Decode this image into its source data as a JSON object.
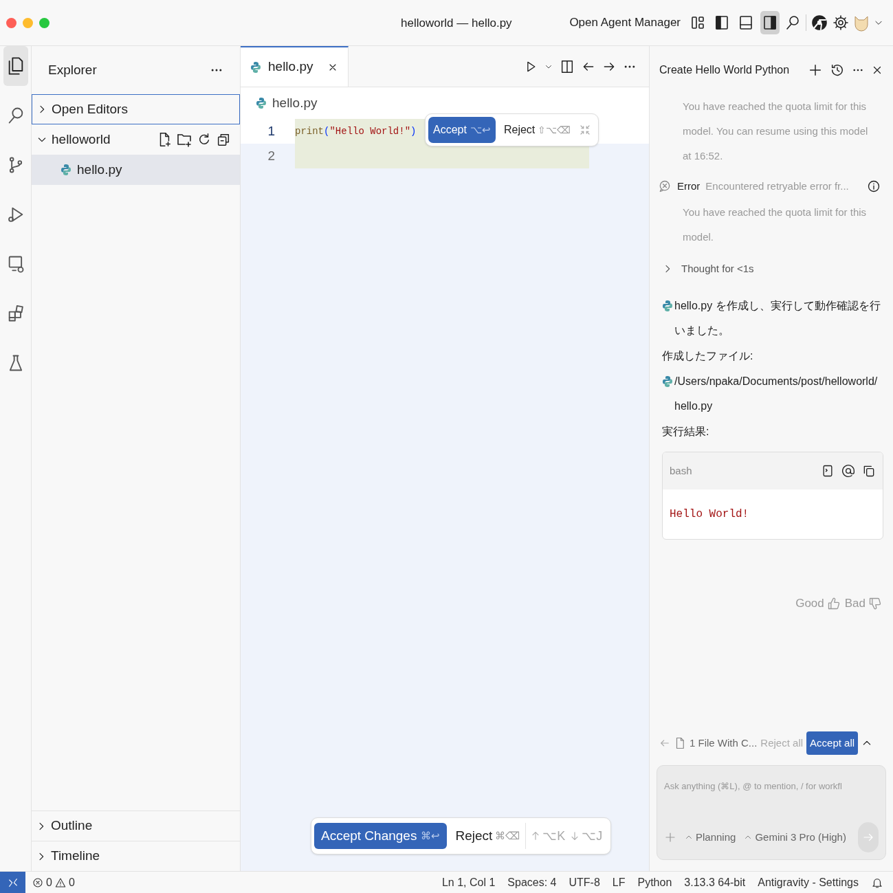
{
  "window": {
    "title": "helloworld — hello.py"
  },
  "title_bar": {
    "agent_manager": "Open Agent Manager",
    "layout_buttons": [
      {
        "kind": "customize",
        "selected": false
      },
      {
        "kind": "left",
        "selected": false
      },
      {
        "kind": "panel",
        "selected": false
      },
      {
        "kind": "right",
        "selected": true
      }
    ]
  },
  "activity_bar": [
    {
      "kind": "explorer",
      "selected": true
    },
    {
      "kind": "search",
      "selected": false
    },
    {
      "kind": "source_control",
      "selected": false
    },
    {
      "kind": "run",
      "selected": false
    },
    {
      "kind": "remote",
      "selected": false
    },
    {
      "kind": "extensions",
      "selected": false
    },
    {
      "kind": "testing",
      "selected": false
    }
  ],
  "sidebar": {
    "title": "Explorer",
    "sections": [
      {
        "label": "Open Editors",
        "expanded": false,
        "focused": true
      },
      {
        "label": "helloworld",
        "expanded": true,
        "focused": false,
        "files": [
          {
            "name": "hello.py",
            "selected": true
          }
        ]
      }
    ],
    "bottom_sections": [
      {
        "label": "Outline",
        "expanded": false
      },
      {
        "label": "Timeline",
        "expanded": false
      }
    ]
  },
  "editor": {
    "tabs": [
      {
        "label": "hello.py",
        "selected": true
      }
    ],
    "breadcrumb": "hello.py",
    "lines": [
      {
        "number": "1",
        "tokens": [
          {
            "kind": "function",
            "text": "print"
          },
          {
            "kind": "paren",
            "text": "("
          },
          {
            "kind": "string",
            "text": "\"Hello World!\""
          },
          {
            "kind": "paren",
            "text": ")"
          }
        ]
      },
      {
        "number": "2"
      }
    ],
    "inline_review": {
      "accept": "Accept",
      "accept_keys": "⌥↩",
      "reject": "Reject",
      "reject_keys": "⇧⌥⌫"
    },
    "review_bar": {
      "accept": "Accept Changes",
      "accept_keys": "⌘↩",
      "reject": "Reject",
      "reject_keys": "⌘⌫",
      "previous_keys": "⌥K",
      "next_keys": "⌥J"
    }
  },
  "chat": {
    "title": "Create Hello World Python",
    "messages": [
      {
        "kind": "notice",
        "text": "You have reached the quota limit for this model. You can resume using this model at 16:52."
      },
      {
        "kind": "error",
        "label": "Error",
        "text": "Encountered retryable error fr..."
      },
      {
        "kind": "notice",
        "text": "You have reached the quota limit for this model."
      },
      {
        "kind": "thought",
        "text": "Thought for <1s",
        "expanded": false
      },
      {
        "kind": "file_line",
        "file": "hello.py",
        "text": "を作成し、実行して動作確認を行いました。"
      },
      {
        "kind": "text",
        "text": "作成したファイル:"
      },
      {
        "kind": "file_line",
        "file": "/Users/npaka/Documents/post/helloworld/hello.py"
      },
      {
        "kind": "text",
        "text": "実行結果:"
      },
      {
        "kind": "code",
        "language": "bash",
        "output": "Hello World!"
      }
    ],
    "feedback": {
      "good": "Good",
      "bad": "Bad"
    },
    "changes": {
      "summary": "1 File With C...",
      "reject": "Reject all",
      "accept": "Accept all"
    },
    "input": {
      "placeholder": "Ask anything (⌘L), @ to mention, / for workfl",
      "mode": "Planning",
      "model": "Gemini 3 Pro (High)"
    }
  },
  "status_bar": {
    "errors": "0",
    "warnings": "0",
    "items": [
      "Ln 1, Col 1",
      "Spaces: 4",
      "UTF-8",
      "LF",
      "Python",
      "3.13.3 64-bit",
      "Antigravity - Settings"
    ]
  }
}
